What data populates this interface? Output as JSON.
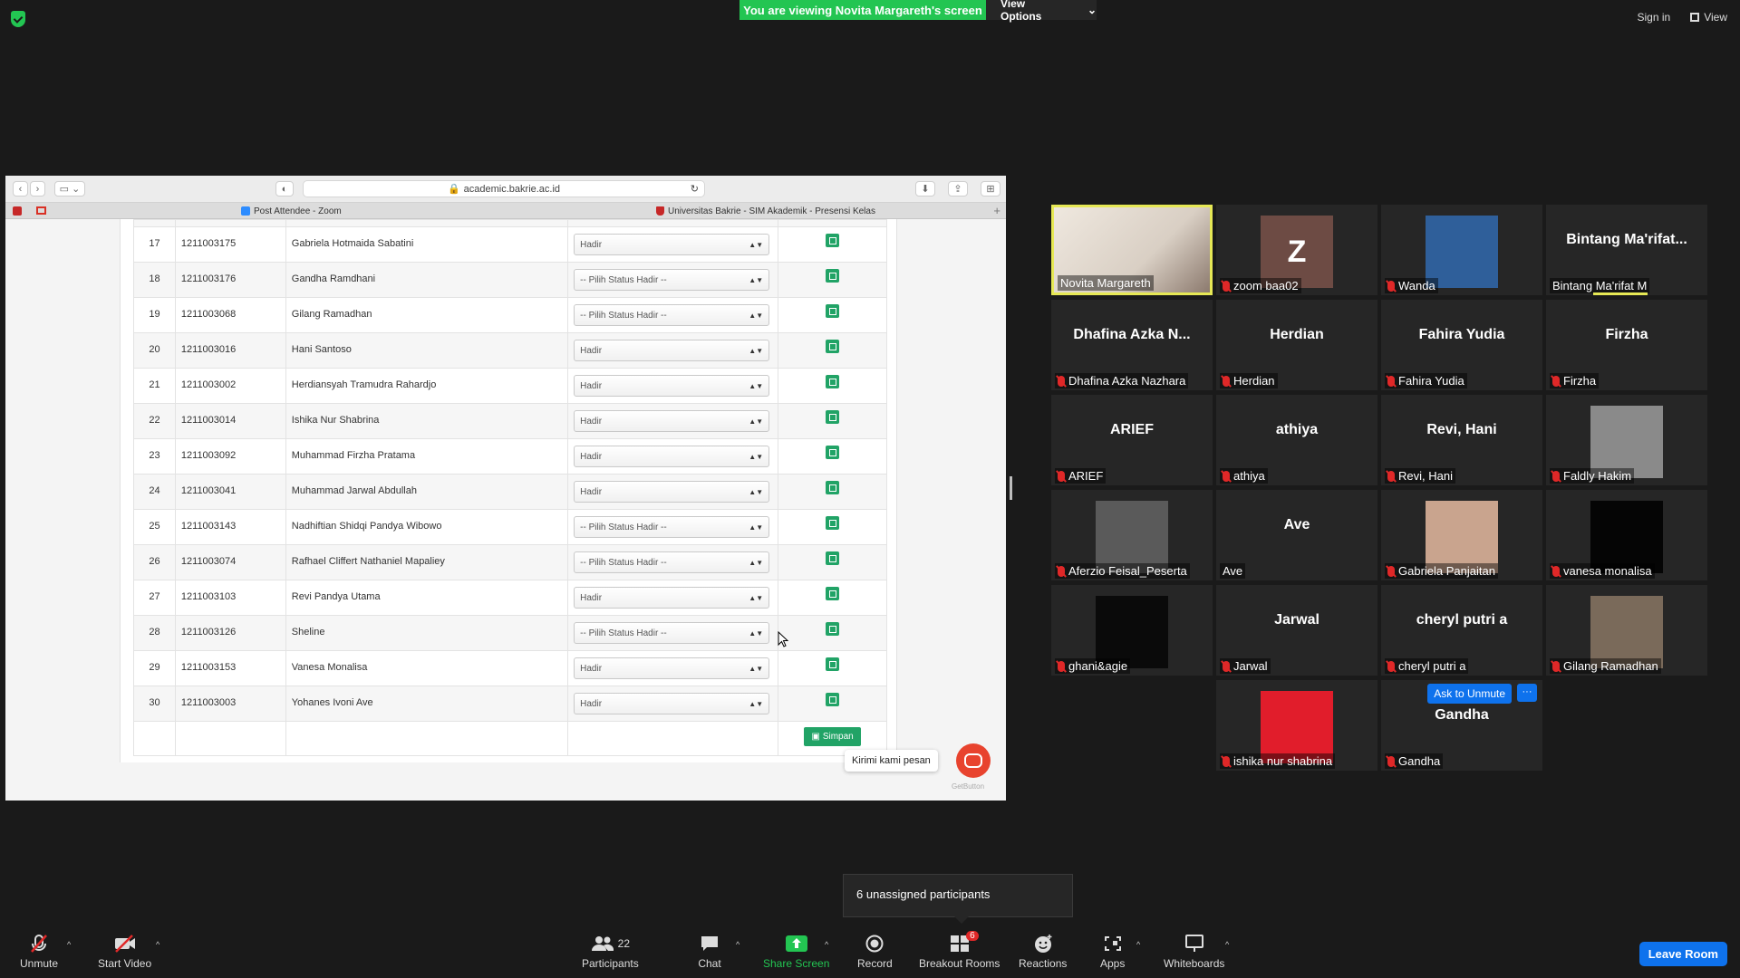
{
  "banner": {
    "viewing": "You are viewing Novita Margareth's screen",
    "view_options": "View Options",
    "sign_in": "Sign in",
    "view": "View"
  },
  "browser": {
    "url": "academic.bakrie.ac.id",
    "tabs": [
      "Post Attendee - Zoom",
      "Universitas Bakrie - SIM Akademik - Presensi Kelas"
    ]
  },
  "attendance": {
    "rows": [
      {
        "no": "17",
        "nim": "1211003175",
        "name": "Gabriela Hotmaida Sabatini",
        "status": "Hadir"
      },
      {
        "no": "18",
        "nim": "1211003176",
        "name": "Gandha Ramdhani",
        "status": "-- Pilih Status Hadir --"
      },
      {
        "no": "19",
        "nim": "1211003068",
        "name": "Gilang Ramadhan",
        "status": "-- Pilih Status Hadir --"
      },
      {
        "no": "20",
        "nim": "1211003016",
        "name": "Hani Santoso",
        "status": "Hadir"
      },
      {
        "no": "21",
        "nim": "1211003002",
        "name": "Herdiansyah Tramudra Rahardjo",
        "status": "Hadir"
      },
      {
        "no": "22",
        "nim": "1211003014",
        "name": "Ishika Nur Shabrina",
        "status": "Hadir"
      },
      {
        "no": "23",
        "nim": "1211003092",
        "name": "Muhammad Firzha Pratama",
        "status": "Hadir"
      },
      {
        "no": "24",
        "nim": "1211003041",
        "name": "Muhammad Jarwal Abdullah",
        "status": "Hadir"
      },
      {
        "no": "25",
        "nim": "1211003143",
        "name": "Nadhiftian Shidqi Pandya Wibowo",
        "status": "-- Pilih Status Hadir --"
      },
      {
        "no": "26",
        "nim": "1211003074",
        "name": "Rafhael Cliffert Nathaniel Mapaliey",
        "status": "-- Pilih Status Hadir --"
      },
      {
        "no": "27",
        "nim": "1211003103",
        "name": "Revi Pandya Utama",
        "status": "Hadir"
      },
      {
        "no": "28",
        "nim": "1211003126",
        "name": "Sheline",
        "status": "-- Pilih Status Hadir --"
      },
      {
        "no": "29",
        "nim": "1211003153",
        "name": "Vanesa Monalisa",
        "status": "Hadir"
      },
      {
        "no": "30",
        "nim": "1211003003",
        "name": "Yohanes Ivoni Ave",
        "status": "Hadir"
      }
    ],
    "save_label": "Simpan",
    "chat_tooltip": "Kirimi kami pesan",
    "getbutton": "GetButton"
  },
  "participants": [
    {
      "label": "Novita Margareth",
      "big": "",
      "muted": false,
      "type": "video",
      "color": "#d9cfc4"
    },
    {
      "label": "zoom baa02",
      "big": "",
      "muted": true,
      "type": "avatar",
      "avatar": "Z",
      "color": "#6d4b44"
    },
    {
      "label": "Wanda",
      "big": "",
      "muted": true,
      "type": "photo",
      "color": "#2f5f9a"
    },
    {
      "label": "Bintang Ma'rifat M",
      "big": "Bintang  Ma'rifat...",
      "muted": false,
      "type": "name"
    },
    {
      "label": "Dhafina Azka Nazhara",
      "big": "Dhafina  Azka  N...",
      "muted": true,
      "type": "name"
    },
    {
      "label": "Herdian",
      "big": "Herdian",
      "muted": true,
      "type": "name"
    },
    {
      "label": "Fahira Yudia",
      "big": "Fahira Yudia",
      "muted": true,
      "type": "name"
    },
    {
      "label": "Firzha",
      "big": "Firzha",
      "muted": true,
      "type": "name"
    },
    {
      "label": "ARIEF",
      "big": "ARIEF",
      "muted": true,
      "type": "name"
    },
    {
      "label": "athiya",
      "big": "athiya",
      "muted": true,
      "type": "name"
    },
    {
      "label": "Revi,  Hani",
      "big": "Revi,  Hani",
      "muted": true,
      "type": "name"
    },
    {
      "label": "Faldly Hakim",
      "big": "",
      "muted": true,
      "type": "photo",
      "color": "#8a8a8a"
    },
    {
      "label": "Aferzio Feisal_Peserta",
      "big": "",
      "muted": true,
      "type": "photo",
      "color": "#5a5a5a"
    },
    {
      "label": "Ave",
      "big": "Ave",
      "muted": false,
      "type": "name"
    },
    {
      "label": "Gabriela Panjaitan",
      "big": "",
      "muted": true,
      "type": "photo",
      "color": "#c9a48e"
    },
    {
      "label": "vanesa monalisa",
      "big": "",
      "muted": true,
      "type": "photo",
      "color": "#050505"
    },
    {
      "label": "ghani&agie",
      "big": "",
      "muted": true,
      "type": "photo",
      "color": "#0a0a0a"
    },
    {
      "label": "Jarwal",
      "big": "Jarwal",
      "muted": true,
      "type": "name"
    },
    {
      "label": "cheryl putri a",
      "big": "cheryl putri a",
      "muted": true,
      "type": "name"
    },
    {
      "label": "Gilang Ramadhan",
      "big": "",
      "muted": true,
      "type": "photo",
      "color": "#7a6a5a"
    },
    {
      "label": "ishika nur shabrina",
      "big": "",
      "muted": true,
      "type": "photo",
      "color": "#e11d2b"
    },
    {
      "label": "Gandha",
      "big": "Gandha",
      "muted": true,
      "type": "name"
    }
  ],
  "gallery_actions": {
    "ask_to_unmute": "Ask to Unmute",
    "more": "···"
  },
  "unassigned": "6 unassigned participants",
  "toolbar": {
    "unmute": "Unmute",
    "start_video": "Start Video",
    "participants": "Participants",
    "participants_count": "22",
    "chat": "Chat",
    "share_screen": "Share Screen",
    "record": "Record",
    "breakout_rooms": "Breakout Rooms",
    "breakout_badge": "6",
    "reactions": "Reactions",
    "apps": "Apps",
    "whiteboards": "Whiteboards",
    "leave_room": "Leave Room"
  }
}
